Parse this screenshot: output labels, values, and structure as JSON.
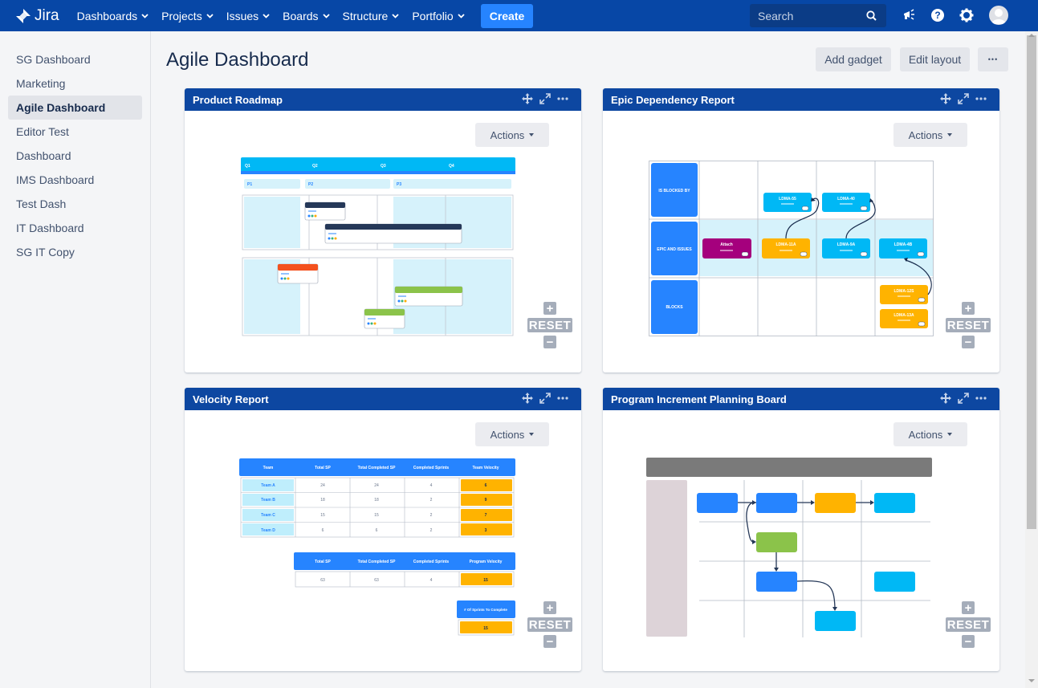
{
  "app": {
    "name": "Jira"
  },
  "nav": {
    "items": [
      {
        "label": "Dashboards"
      },
      {
        "label": "Projects"
      },
      {
        "label": "Issues"
      },
      {
        "label": "Boards"
      },
      {
        "label": "Structure"
      },
      {
        "label": "Portfolio"
      }
    ],
    "create_label": "Create",
    "search_placeholder": "Search",
    "icons": [
      "notifications-icon",
      "help-icon",
      "settings-icon",
      "user-avatar"
    ]
  },
  "sidebar": {
    "items": [
      {
        "label": "SG Dashboard",
        "active": false
      },
      {
        "label": "Marketing",
        "active": false
      },
      {
        "label": "Agile Dashboard",
        "active": true
      },
      {
        "label": "Editor Test",
        "active": false
      },
      {
        "label": "Dashboard",
        "active": false
      },
      {
        "label": "IMS Dashboard",
        "active": false
      },
      {
        "label": "Test Dash",
        "active": false
      },
      {
        "label": "IT Dashboard",
        "active": false
      },
      {
        "label": "SG IT Copy",
        "active": false
      }
    ]
  },
  "header": {
    "title": "Agile Dashboard",
    "add_gadget_label": "Add gadget",
    "edit_layout_label": "Edit layout",
    "more_label": "•••"
  },
  "gadgets": {
    "roadmap": {
      "title": "Product Roadmap",
      "actions_label": "Actions",
      "reset_label": "RESET",
      "quarters": [
        "Q1",
        "Q2",
        "Q3",
        "Q4"
      ],
      "phases": [
        "P1",
        "P2",
        "P3"
      ]
    },
    "epic": {
      "title": "Epic Dependency Report",
      "actions_label": "Actions",
      "reset_label": "RESET",
      "rows": [
        "IS BLOCKED BY",
        "EPIC AND ISSUES",
        "BLOCKS"
      ],
      "cards": {
        "blocked_1": "LDMA-55",
        "blocked_2": "LDMA-40",
        "attach": "Attach",
        "epic_1": "LDMA-11A",
        "epic_2": "LDMA-9A",
        "epic_3": "LDMA-4B",
        "blocks_1": "LDMA-12S",
        "blocks_2": "LDMA-13A"
      }
    },
    "velocity": {
      "title": "Velocity Report",
      "actions_label": "Actions",
      "reset_label": "RESET",
      "team_table": {
        "headers": [
          "Team",
          "Total SP",
          "Total Completed SP",
          "Completed Sprints",
          "Team Velocity"
        ],
        "rows": [
          [
            "Team A",
            "24",
            "24",
            "4",
            "6"
          ],
          [
            "Team B",
            "18",
            "18",
            "2",
            "9"
          ],
          [
            "Team C",
            "15",
            "15",
            "2",
            "7"
          ],
          [
            "Team D",
            "6",
            "6",
            "2",
            "3"
          ]
        ]
      },
      "program_table": {
        "headers": [
          "Total SP",
          "Total Completed SP",
          "Completed Sprints",
          "Program Velocity"
        ],
        "row": [
          "63",
          "63",
          "4",
          "15"
        ]
      },
      "sprints_table": {
        "header": "# Of Sprints To Complete",
        "value": "15"
      }
    },
    "pi": {
      "title": "Program Increment Planning Board",
      "actions_label": "Actions",
      "reset_label": "RESET"
    }
  },
  "colors": {
    "nav_bg": "#0747a6",
    "gadget_header": "#0d47a1",
    "accent_blue": "#2684ff",
    "light_blue": "#00b8f5",
    "orange": "#ffb300",
    "purple": "#a5007d",
    "green": "#8bc34a",
    "red": "#f4511e"
  }
}
